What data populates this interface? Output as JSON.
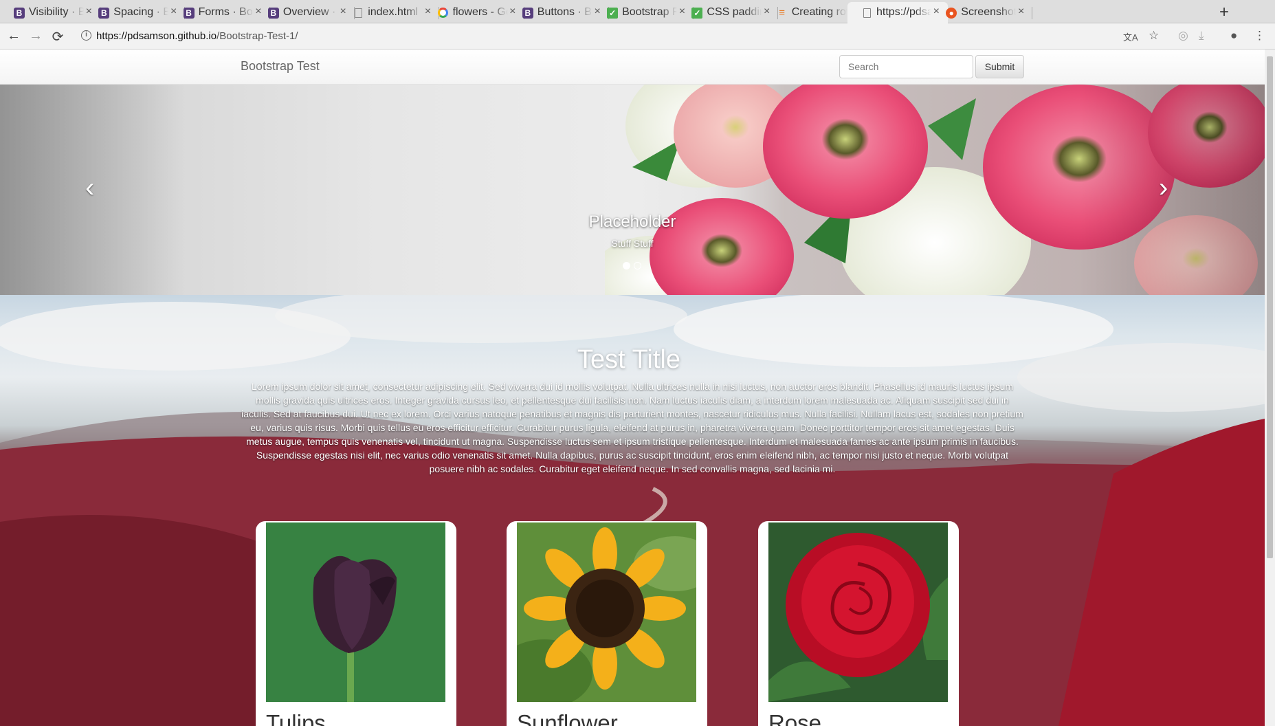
{
  "browser": {
    "tabs": [
      {
        "title": "Visibility · Bootstrap",
        "icon": "bootstrap-icon"
      },
      {
        "title": "Spacing · Bootstrap",
        "icon": "bootstrap-icon"
      },
      {
        "title": "Forms · Bootstrap",
        "icon": "bootstrap-icon"
      },
      {
        "title": "Overview · Bootstrap",
        "icon": "bootstrap-icon"
      },
      {
        "title": "index.html",
        "icon": "document-icon"
      },
      {
        "title": "flowers - Google",
        "icon": "google-icon"
      },
      {
        "title": "Buttons · Bootstrap",
        "icon": "bootstrap-icon"
      },
      {
        "title": "Bootstrap Forms",
        "icon": "w3schools-icon"
      },
      {
        "title": "CSS padding",
        "icon": "w3schools-icon"
      },
      {
        "title": "Creating rows",
        "icon": "stackoverflow-icon"
      },
      {
        "title": "https://pdsamson.github.io",
        "icon": "document-icon"
      },
      {
        "title": "Screenshot",
        "icon": "ubuntu-icon"
      }
    ],
    "active_tab": 10,
    "url_host": "https://pdsamson.github.io",
    "url_path": "/Bootstrap-Test-1/"
  },
  "navbar": {
    "brand": "Bootstrap Test",
    "search_placeholder": "Search",
    "submit_label": "Submit"
  },
  "carousel": {
    "caption_title": "Placeholder",
    "caption_text": "Stuff Stuff",
    "prev_glyph": "‹",
    "next_glyph": "›",
    "slide_count": 2,
    "active_slide": 0
  },
  "hero": {
    "title": "Test Title",
    "text": "Lorem ipsum dolor sit amet, consectetur adipiscing elit. Sed viverra dui id mollis volutpat. Nulla ultrices nulla in nisi luctus, non auctor eros blandit. Phasellus id mauris luctus ipsum mollis gravida quis ultrices eros. Integer gravida cursus leo, et pellentesque dui facilisis non. Nam luctus iaculis diam, a interdum lorem malesuada ac. Aliquam suscipit sed dui in iaculis. Sed at faucibus dui. Ut nec ex lorem. Orci varius natoque penatibus et magnis dis parturient montes, nascetur ridiculus mus. Nulla facilisi. Nullam lacus est, sodales non pretium eu, varius quis risus. Morbi quis tellus eu eros efficitur efficitur. Curabitur purus ligula, eleifend at purus in, pharetra viverra quam. Donec porttitor tempor eros sit amet egestas. Duis metus augue, tempus quis venenatis vel, tincidunt ut magna. Suspendisse luctus sem et ipsum tristique pellentesque. Interdum et malesuada fames ac ante ipsum primis in faucibus. Suspendisse egestas nisi elit, nec varius odio venenatis sit amet. Nulla dapibus, purus ac suscipit tincidunt, eros enim eleifend nibh, ac tempor nisi justo et neque. Morbi volutpat posuere nibh ac sodales. Curabitur eget eleifend neque. In sed convallis magna, sed lacinia mi."
  },
  "cards": [
    {
      "name": "Tulips",
      "image": "tulip"
    },
    {
      "name": "Sunflower",
      "image": "sunflower"
    },
    {
      "name": "Rose",
      "image": "rose"
    }
  ],
  "colors": {
    "bootstrap_purple": "#563d7c",
    "tulip": "#3a1f33",
    "sunflower": "#f4b01a",
    "rose": "#c8102e",
    "field": "#8d2d3d"
  }
}
